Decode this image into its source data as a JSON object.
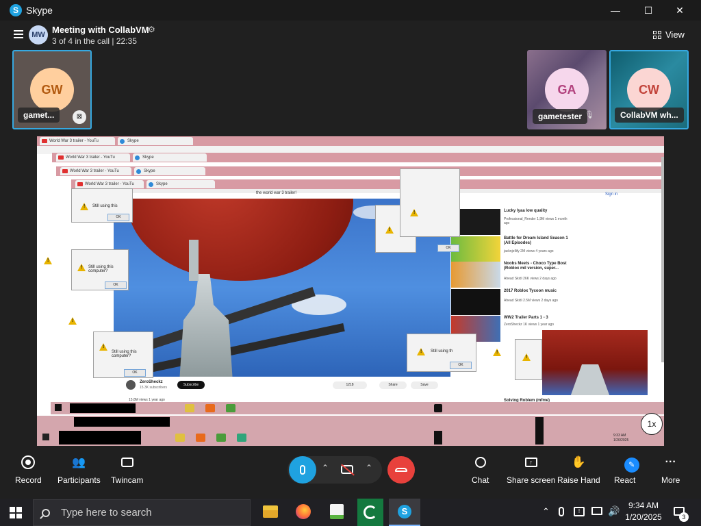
{
  "window": {
    "app_title": "Skype",
    "minimize": "—",
    "maximize": "☐",
    "close": "✕"
  },
  "call": {
    "avatar_initials": "MW",
    "title": "Meeting with CollabVM",
    "subtitle": "3 of 4 in the call | 22:35",
    "view_label": "View"
  },
  "participants": [
    {
      "initials": "GW",
      "name": "gamet...",
      "avatar_color": "#ffcf9e",
      "text_color": "#b25a10"
    },
    {
      "initials": "GA",
      "name": "gametester",
      "avatar_color": "#f6d7ec",
      "text_color": "#b2427e"
    },
    {
      "initials": "CW",
      "name": "CollabVM wh...",
      "avatar_color": "#fbd6d3",
      "text_color": "#c2433a"
    }
  ],
  "share": {
    "tabs": [
      {
        "label": "World War 3 trailer - YouTu"
      },
      {
        "label": "Skype"
      }
    ],
    "video_title": "the world war 3 trailer!",
    "channel": "ZeroSheckz",
    "subscribers": "15.3K subscribers",
    "subscribe": "Subscribe",
    "likes": "1218",
    "share_label": "Share",
    "save_label": "Save",
    "views": "15.8M views  1 year ago",
    "sign_in": "Sign in",
    "dialog_text_a": "Still using this",
    "dialog_text_b": "Still using this computer?",
    "dialog_text_c": "Still using th",
    "dialog_text_d": "Still using this computer?",
    "ok": "OK",
    "suggestions": [
      {
        "title": "Lucky lyaa low quality",
        "meta": "Professional_Render  1,9M views  1 month ago"
      },
      {
        "title": "Battle for Dream Island Season 1 (All Episodes)",
        "meta": "jacknjellify  2M views  4 years ago"
      },
      {
        "title": "Noobs Meets - Choco Type Bost (Roblox mil version, super...",
        "meta": "Ahead Skidi  26K views  2 days ago"
      },
      {
        "title": "2017 Roblox Tycoon music",
        "meta": "Ahead Skidi  2.5M views  2 days ago"
      },
      {
        "title": "WW2 Trailer Parts 1 - 3",
        "meta": "ZeroSheckz  1K views  1 year ago"
      }
    ],
    "solving_text": "Solving Roblem (mfme)",
    "clock_time": "9:33 AM",
    "clock_date": "1/20/2025",
    "speed_badge": "1x"
  },
  "toolbar": {
    "record": "Record",
    "participants": "Participants",
    "twincam": "Twincam",
    "chat": "Chat",
    "share_screen": "Share screen",
    "raise_hand": "Raise Hand",
    "react": "React",
    "more": "More"
  },
  "taskbar": {
    "search_placeholder": "Type here to search",
    "time": "9:34 AM",
    "date": "1/20/2025",
    "notification_count": "3"
  },
  "colors": {
    "accent_blue": "#1fa2e0",
    "end_call_red": "#e8413c",
    "tile_border": "#36a9e1",
    "react_blue": "#1a8cff"
  }
}
